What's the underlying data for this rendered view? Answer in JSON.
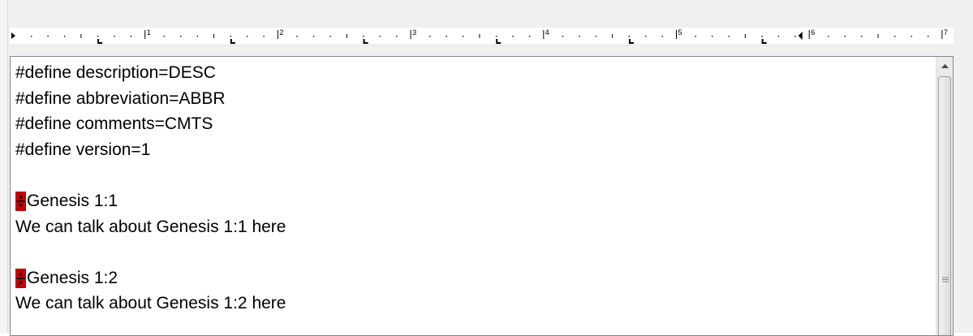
{
  "ruler": {
    "numbers": [
      "1",
      "2",
      "3",
      "4",
      "5",
      "6",
      "7"
    ]
  },
  "editor": {
    "lines": [
      {
        "text": "#define description=DESC",
        "marker": false
      },
      {
        "text": "#define abbreviation=ABBR",
        "marker": false
      },
      {
        "text": "#define comments=CMTS",
        "marker": false
      },
      {
        "text": "#define version=1",
        "marker": false
      },
      {
        "text": "",
        "marker": false
      },
      {
        "text": "Genesis 1:1",
        "marker": true
      },
      {
        "text": "We can talk about Genesis 1:1 here",
        "marker": false
      },
      {
        "text": "",
        "marker": false
      },
      {
        "text": "Genesis 1:2",
        "marker": true
      },
      {
        "text": "We can talk about Genesis 1:2 here",
        "marker": false
      }
    ]
  },
  "colors": {
    "marker": "#c00000",
    "text": "#000000",
    "ruler_bg": "#ffffff",
    "chrome": "#f0f0f0"
  },
  "icons": {
    "marker_glyph": "section-divider-icon",
    "scroll_up": "scroll-up-arrow-icon",
    "scroll_grip": "scroll-grip-icon",
    "first_line_indent": "first-line-indent-icon",
    "right_indent": "right-indent-icon",
    "tab_stop": "tab-stop-icon"
  }
}
